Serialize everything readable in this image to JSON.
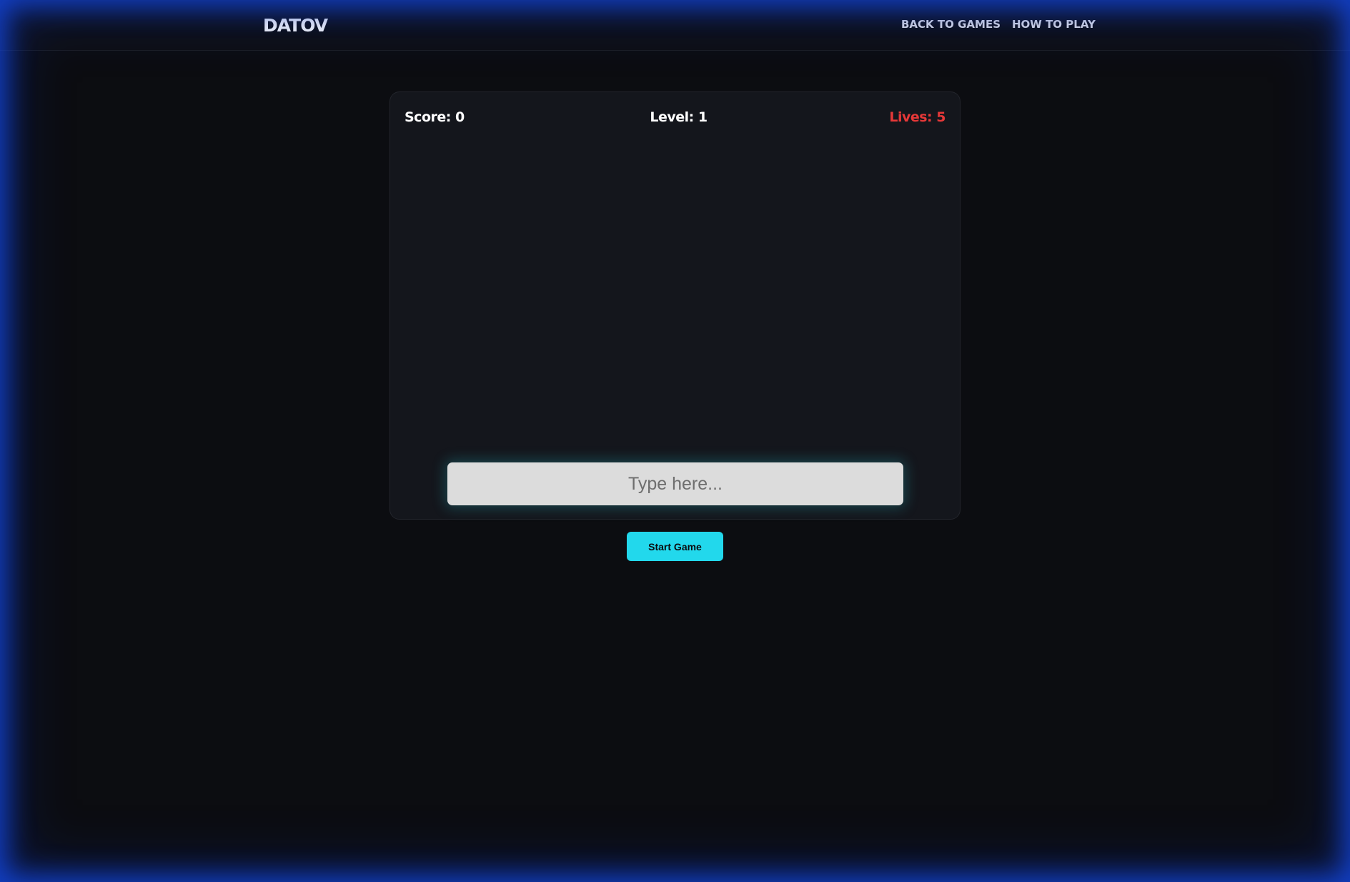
{
  "header": {
    "logo": "DATOV",
    "nav": {
      "back_to_games": "BACK TO GAMES",
      "how_to_play": "HOW TO PLAY"
    }
  },
  "game": {
    "score_text": "Score: 0",
    "level_text": "Level: 1",
    "lives_text": "Lives: 5",
    "input": {
      "placeholder": "Type here...",
      "value": ""
    }
  },
  "controls": {
    "start_label": "Start Game"
  },
  "colors": {
    "background": "#0c0d11",
    "panel": "#14161c",
    "accent": "#22d8ec",
    "lives": "#e63838",
    "edge_glow": "#1446dc"
  }
}
